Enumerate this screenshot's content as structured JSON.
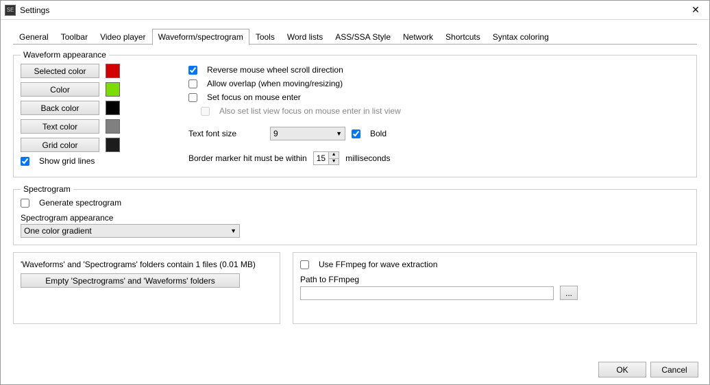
{
  "window": {
    "title": "Settings",
    "close_glyph": "✕"
  },
  "tabs": {
    "items": [
      "General",
      "Toolbar",
      "Video player",
      "Waveform/spectrogram",
      "Tools",
      "Word lists",
      "ASS/SSA Style",
      "Network",
      "Shortcuts",
      "Syntax coloring"
    ],
    "active_index": 3
  },
  "waveform_appearance": {
    "legend": "Waveform appearance",
    "buttons": {
      "selected_color": "Selected color",
      "color": "Color",
      "back_color": "Back color",
      "text_color": "Text color",
      "grid_color": "Grid color"
    },
    "swatches": {
      "selected": "#d40000",
      "color": "#7bdc00",
      "back": "#000000",
      "text": "#808080",
      "grid": "#1c1c1c"
    },
    "show_grid_lines_label": "Show grid lines",
    "show_grid_lines": true,
    "reverse_wheel_label": "Reverse mouse wheel scroll direction",
    "reverse_wheel": true,
    "allow_overlap_label": "Allow overlap (when moving/resizing)",
    "allow_overlap": false,
    "set_focus_label": "Set focus on mouse enter",
    "set_focus": false,
    "also_set_listview_label": "Also set list view focus on mouse enter in list view",
    "also_set_listview": false,
    "font_size_label": "Text font size",
    "font_size_value": "9",
    "bold_label": "Bold",
    "bold": true,
    "border_marker_label_pre": "Border marker hit must be within",
    "border_marker_value": "15",
    "border_marker_label_post": "milliseconds"
  },
  "spectrogram": {
    "legend": "Spectrogram",
    "generate_label": "Generate spectrogram",
    "generate": false,
    "appearance_label": "Spectrogram appearance",
    "appearance_value": "One color gradient"
  },
  "folders": {
    "info": "'Waveforms' and 'Spectrograms' folders contain 1 files (0.01 MB)",
    "empty_button": "Empty 'Spectrograms' and 'Waveforms' folders"
  },
  "ffmpeg": {
    "use_label": "Use FFmpeg for wave extraction",
    "use": false,
    "path_label": "Path to FFmpeg",
    "path_value": "",
    "browse_label": "..."
  },
  "footer": {
    "ok": "OK",
    "cancel": "Cancel"
  }
}
